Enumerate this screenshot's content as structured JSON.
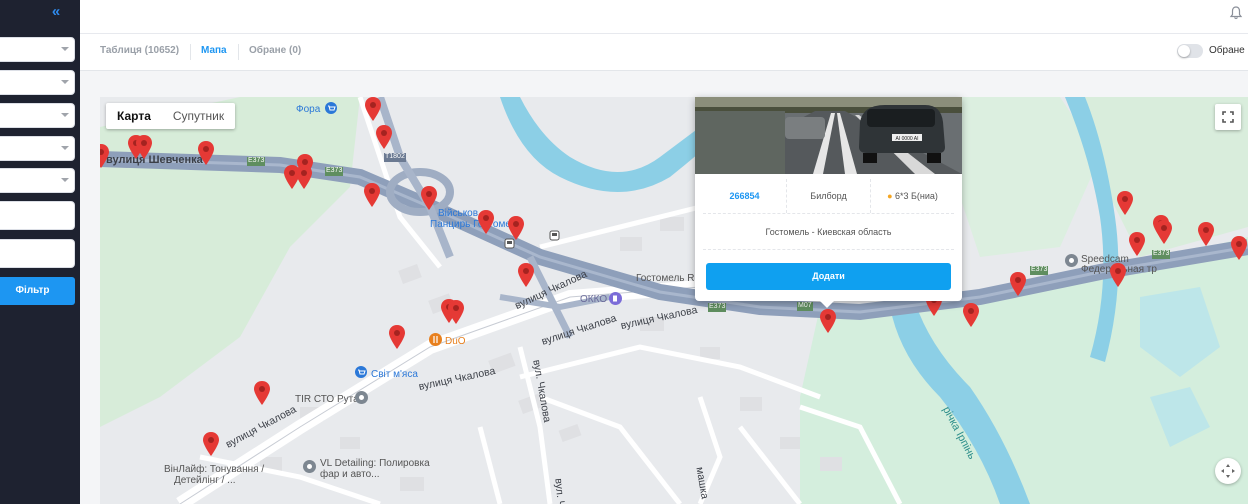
{
  "sidebar": {
    "collapse_icon": "«",
    "filter_label": "Фільтр"
  },
  "tabs": [
    {
      "label": "Таблиця (10652)"
    },
    {
      "label": "Мапа"
    },
    {
      "label": "Обране (0)"
    }
  ],
  "favorites_toggle": {
    "label": "Обране",
    "on": false
  },
  "map": {
    "type_buttons": [
      "Карта",
      "Супутник"
    ],
    "labels": {
      "fora": "Фора",
      "vulytsia_shevchenka": "вулиця Шевченка",
      "e373_a": "E373",
      "e373_b": "E373",
      "e373_c": "E373",
      "e373_d": "E373",
      "e373_e": "E373",
      "t1802": "T1802",
      "viiskove": "Військов",
      "pantsyr": "Панцирь Гостомел",
      "hostomel_road": "Гостомель Ro",
      "okko": "ОККО",
      "chkalova_1": "вулиця Чкалова",
      "chkalova_2": "вулиця Чкалова",
      "chkalova_3": "вулиця Чкалова",
      "chkalova_4": "вулиця Чкалова",
      "chkalova_5": "вулиця Чкалова",
      "vul_chk_1": "вул. Чкалова",
      "vul_chk_2": "вул. Ч",
      "duo": "DuO",
      "svit_myasa": "Світ м'яса",
      "tir_sto": "TIR СТО Рута",
      "vl_detailing_1": "VL Detailing: Полировка",
      "vl_detailing_2": "фар и авто...",
      "vinlife_1": "ВінЛайф: Тонування /",
      "vinlife_2": "Детейлінг / ...",
      "m07": "M07",
      "speedcam_1": "Speedcam",
      "speedcam_2": "Федеральная тр",
      "richka_irpin": "річка Ірпінь",
      "mashka": "машка"
    }
  },
  "popup": {
    "id": "266854",
    "type": "Билборд",
    "size": "6*3 Б(ниа)",
    "location": "Гостомель - Киевская область",
    "add_label": "Додати",
    "plate": "AI 0000 AI"
  },
  "colors": {
    "sidebar_bg": "#1e2230",
    "accent": "#1d96f2",
    "pin": "#e53935"
  }
}
